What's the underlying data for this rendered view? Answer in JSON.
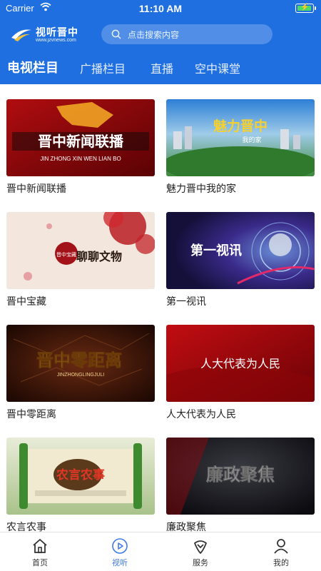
{
  "status_bar": {
    "carrier": "Carrier",
    "time": "11:10 AM"
  },
  "header": {
    "logo_title": "视听晋中",
    "logo_subtitle": "www.jzvnews.com",
    "search_placeholder": "点击搜索内容",
    "colors": {
      "background": "#1f6fe0",
      "text": "#ffffff"
    }
  },
  "tabs": [
    {
      "label": "电视栏目",
      "active": true
    },
    {
      "label": "广播栏目",
      "active": false
    },
    {
      "label": "直播",
      "active": false
    },
    {
      "label": "空中课堂",
      "active": false
    }
  ],
  "programs": [
    {
      "title": "晋中新闻联播",
      "art_text": "晋中新闻联播",
      "art_subtext": "JIN ZHONG XIN WEN LIAN BO"
    },
    {
      "title": "魅力晋中我的家",
      "art_text": "魅力晋中",
      "art_subtext": "我的家"
    },
    {
      "title": "晋中宝藏",
      "art_text": "聊聊文物",
      "art_subtext": "晋中宝藏"
    },
    {
      "title": "第一视讯",
      "art_text": "第一视讯",
      "art_subtext": ""
    },
    {
      "title": "晋中零距离",
      "art_text": "晋中零距离",
      "art_subtext": "JINZHONGLINGJULI"
    },
    {
      "title": "人大代表为人民",
      "art_text": "人大代表为人民",
      "art_subtext": ""
    },
    {
      "title": "农言农事",
      "art_text": "农言农事",
      "art_subtext": ""
    },
    {
      "title": "廉政聚焦",
      "art_text": "廉政聚焦",
      "art_subtext": ""
    }
  ],
  "bottom_nav": [
    {
      "label": "首页",
      "icon": "home-icon",
      "active": false
    },
    {
      "label": "视听",
      "icon": "play-icon",
      "active": true
    },
    {
      "label": "服务",
      "icon": "service-icon",
      "active": false
    },
    {
      "label": "我的",
      "icon": "user-icon",
      "active": false
    }
  ],
  "accent_color": "#3d7be5"
}
